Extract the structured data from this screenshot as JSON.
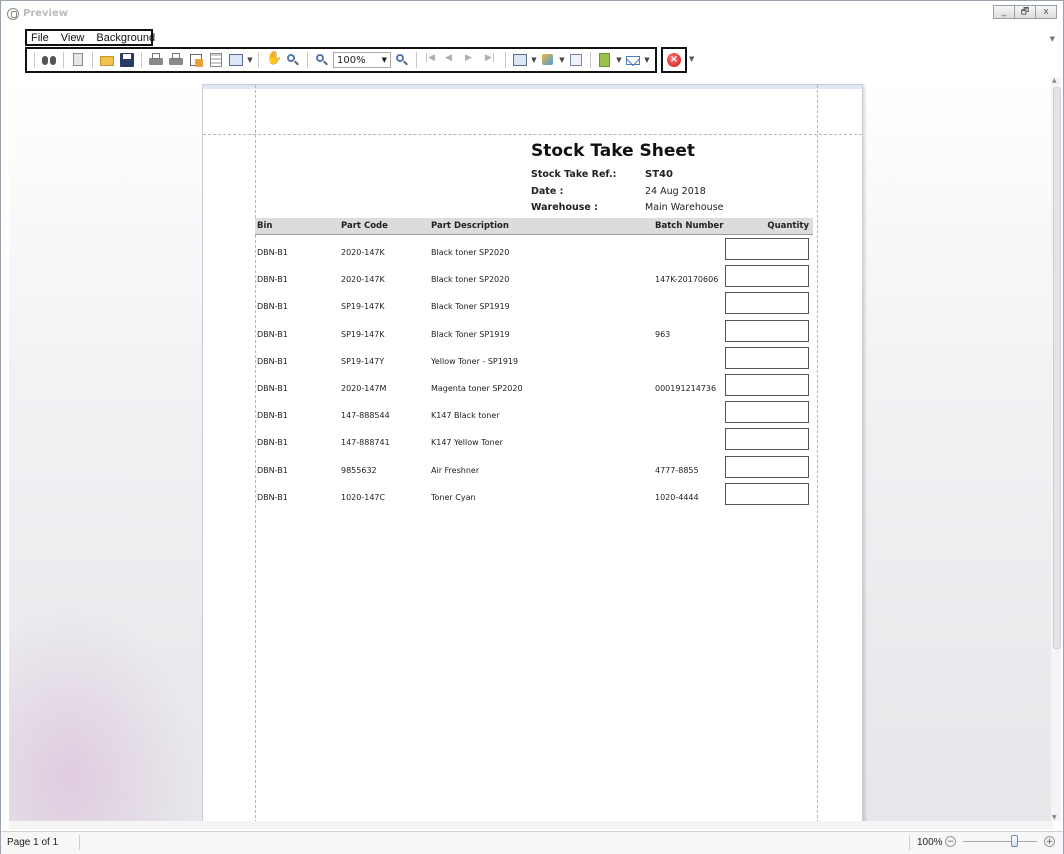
{
  "window": {
    "title": "Preview",
    "controls": [
      "_",
      "🗗",
      "x"
    ]
  },
  "menu": {
    "items": [
      "File",
      "View",
      "Background"
    ]
  },
  "toolbar": {
    "zoom_value": "100%"
  },
  "report": {
    "title": "Stock Take Sheet",
    "fields": [
      {
        "label": "Stock Take Ref.:",
        "value": "ST40"
      },
      {
        "label": "Date :",
        "value": "24 Aug 2018"
      },
      {
        "label": "Warehouse :",
        "value": "Main Warehouse"
      }
    ],
    "columns": [
      "Bin",
      "Part Code",
      "Part Description",
      "Batch Number",
      "Quantity"
    ],
    "rows": [
      {
        "bin": "DBN-B1",
        "part_code": "2020-147K",
        "description": "Black toner SP2020",
        "batch": ""
      },
      {
        "bin": "DBN-B1",
        "part_code": "2020-147K",
        "description": "Black toner SP2020",
        "batch": "147K-20170606"
      },
      {
        "bin": "DBN-B1",
        "part_code": "SP19-147K",
        "description": "Black Toner SP1919",
        "batch": ""
      },
      {
        "bin": "DBN-B1",
        "part_code": "SP19-147K",
        "description": "Black Toner SP1919",
        "batch": "963"
      },
      {
        "bin": "DBN-B1",
        "part_code": "SP19-147Y",
        "description": "Yellow Toner - SP1919",
        "batch": ""
      },
      {
        "bin": "DBN-B1",
        "part_code": "2020-147M",
        "description": "Magenta toner SP2020",
        "batch": "000191214736"
      },
      {
        "bin": "DBN-B1",
        "part_code": "147-888544",
        "description": "K147 Black toner",
        "batch": ""
      },
      {
        "bin": "DBN-B1",
        "part_code": "147-888741",
        "description": "K147 Yellow Toner",
        "batch": ""
      },
      {
        "bin": "DBN-B1",
        "part_code": "9855632",
        "description": "Air Freshner",
        "batch": "4777-8855"
      },
      {
        "bin": "DBN-B1",
        "part_code": "1020-147C",
        "description": "Toner Cyan",
        "batch": "1020-4444"
      }
    ]
  },
  "status": {
    "page_info": "Page 1 of 1",
    "zoom": "100%",
    "zoom_level_percent": 100
  }
}
